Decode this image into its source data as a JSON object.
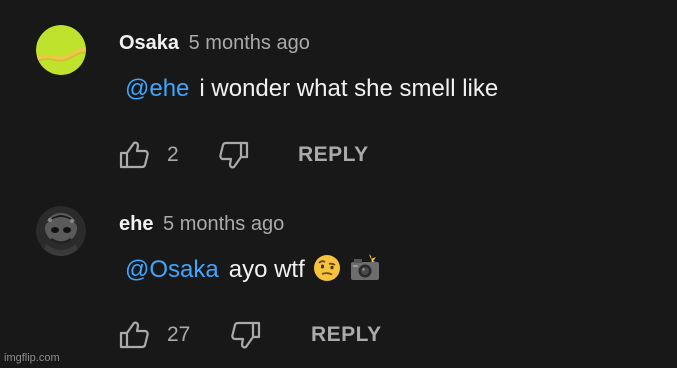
{
  "comments": [
    {
      "author": "Osaka",
      "time": "5 months ago",
      "mention": "@ehe",
      "text": "i wonder what she smell like",
      "likes": "2",
      "reply_label": "REPLY",
      "avatar_icon": "tennis-ball-avatar",
      "emojis": []
    },
    {
      "author": "ehe",
      "time": "5 months ago",
      "mention": "@Osaka",
      "text": "ayo wtf",
      "likes": "27",
      "reply_label": "REPLY",
      "avatar_icon": "dark-character-avatar",
      "emojis": [
        "raised-eyebrow-emoji",
        "camera-with-flash-emoji"
      ]
    }
  ],
  "watermark": "imgflip.com",
  "colors": {
    "background": "#181818",
    "text": "#f1f1f1",
    "muted": "#aaaaaa",
    "mention": "#3ea6ff"
  }
}
